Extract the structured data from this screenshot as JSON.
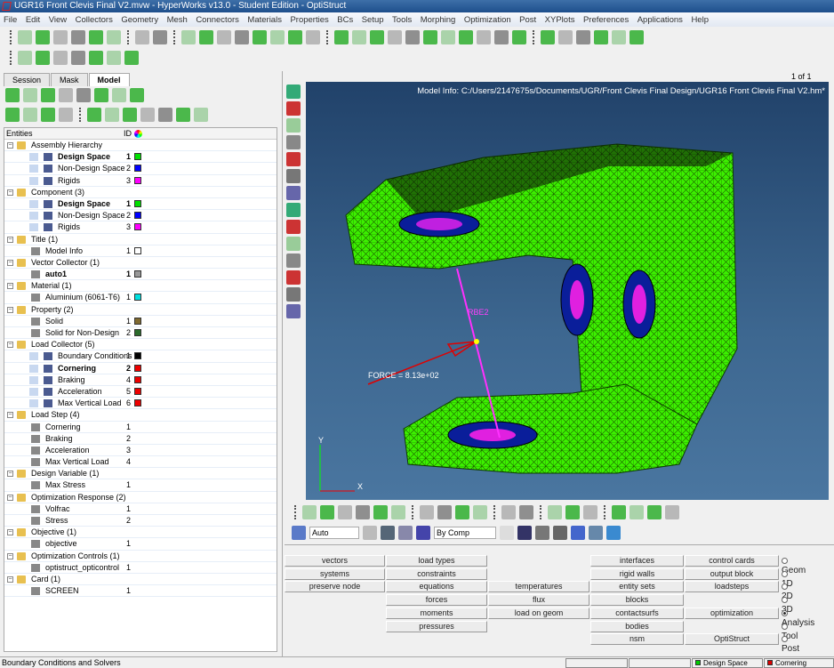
{
  "window": {
    "title": "UGR16 Front Clevis Final V2.mvw - HyperWorks v13.0 - Student Edition - OptiStruct"
  },
  "menu": [
    "File",
    "Edit",
    "View",
    "Collectors",
    "Geometry",
    "Mesh",
    "Connectors",
    "Materials",
    "Properties",
    "BCs",
    "Setup",
    "Tools",
    "Morphing",
    "Optimization",
    "Post",
    "XYPlots",
    "Preferences",
    "Applications",
    "Help"
  ],
  "tabs": [
    {
      "label": "Session"
    },
    {
      "label": "Mask"
    },
    {
      "label": "Model",
      "active": true
    }
  ],
  "tree": {
    "header": {
      "entities": "Entities",
      "id": "ID"
    },
    "rows": [
      {
        "level": 0,
        "label": "Assembly Hierarchy"
      },
      {
        "level": 1,
        "label": "Design Space",
        "id": "1",
        "color": "#00e000",
        "bold": true
      },
      {
        "level": 1,
        "label": "Non-Design Space",
        "id": "2",
        "color": "#0000ff"
      },
      {
        "level": 1,
        "label": "Rigids",
        "id": "3",
        "color": "#ff00ff"
      },
      {
        "level": 0,
        "label": "Component (3)"
      },
      {
        "level": 1,
        "label": "Design Space",
        "id": "1",
        "color": "#00e000",
        "bold": true
      },
      {
        "level": 1,
        "label": "Non-Design Space",
        "id": "2",
        "color": "#0000ff"
      },
      {
        "level": 1,
        "label": "Rigids",
        "id": "3",
        "color": "#ff00ff"
      },
      {
        "level": 0,
        "label": "Title (1)"
      },
      {
        "level": 1,
        "label": "Model Info",
        "id": "1",
        "color": "#ffffff",
        "short": true
      },
      {
        "level": 0,
        "label": "Vector Collector (1)"
      },
      {
        "level": 1,
        "label": "auto1",
        "id": "1",
        "color": "#999999",
        "bold": true,
        "short": true
      },
      {
        "level": 0,
        "label": "Material (1)"
      },
      {
        "level": 1,
        "label": "Aluminium (6061-T6)",
        "id": "1",
        "color": "#00e0e0",
        "short": true
      },
      {
        "level": 0,
        "label": "Property (2)"
      },
      {
        "level": 1,
        "label": "Solid",
        "id": "1",
        "color": "#806a30",
        "short": true
      },
      {
        "level": 1,
        "label": "Solid for Non-Design",
        "id": "2",
        "color": "#2a6a2a",
        "short": true
      },
      {
        "level": 0,
        "label": "Load Collector (5)"
      },
      {
        "level": 1,
        "label": "Boundary Conditions",
        "id": "1",
        "color": "#000000"
      },
      {
        "level": 1,
        "label": "Cornering",
        "id": "2",
        "color": "#ee0000",
        "bold": true
      },
      {
        "level": 1,
        "label": "Braking",
        "id": "4",
        "color": "#ee0000"
      },
      {
        "level": 1,
        "label": "Acceleration",
        "id": "5",
        "color": "#ee0000"
      },
      {
        "level": 1,
        "label": "Max Vertical Load",
        "id": "6",
        "color": "#ee0000"
      },
      {
        "level": 0,
        "label": "Load Step (4)"
      },
      {
        "level": 1,
        "label": "Cornering",
        "id": "1",
        "short": true
      },
      {
        "level": 1,
        "label": "Braking",
        "id": "2",
        "short": true
      },
      {
        "level": 1,
        "label": "Acceleration",
        "id": "3",
        "short": true
      },
      {
        "level": 1,
        "label": "Max Vertical Load",
        "id": "4",
        "short": true
      },
      {
        "level": 0,
        "label": "Design Variable (1)"
      },
      {
        "level": 1,
        "label": "Max Stress",
        "id": "1",
        "short": true
      },
      {
        "level": 0,
        "label": "Optimization Response (2)"
      },
      {
        "level": 1,
        "label": "Volfrac",
        "id": "1",
        "short": true
      },
      {
        "level": 1,
        "label": "Stress",
        "id": "2",
        "short": true
      },
      {
        "level": 0,
        "label": "Objective (1)"
      },
      {
        "level": 1,
        "label": "objective",
        "id": "1",
        "short": true
      },
      {
        "level": 0,
        "label": "Optimization Controls (1)"
      },
      {
        "level": 1,
        "label": "optistruct_opticontrol",
        "id": "1",
        "short": true
      },
      {
        "level": 0,
        "label": "Card (1)"
      },
      {
        "level": 1,
        "label": "SCREEN",
        "id": "1",
        "short": true
      }
    ]
  },
  "viewport": {
    "page": "1 of 1",
    "model_info": "Model Info: C:/Users/2147675s/Documents/UGR/Front Clevis Final Design/UGR16 Front Clevis Final V2.hm*",
    "rbe_label": "RBE2",
    "force_label": "FORCE = 8.13e+02",
    "axis": {
      "y": "Y",
      "x": "X"
    }
  },
  "display_toolbar": {
    "auto": "Auto",
    "by_comp": "By Comp"
  },
  "panel": {
    "buttons": [
      [
        "vectors",
        "systems",
        "preserve node"
      ],
      [
        "load types",
        "constraints",
        "equations",
        "forces",
        "moments",
        "pressures"
      ],
      [
        "temperatures",
        "flux",
        "load on geom"
      ],
      [
        "interfaces",
        "rigid walls",
        "entity sets",
        "blocks",
        "contactsurfs",
        "bodies",
        "nsm"
      ],
      [
        "control cards",
        "output block",
        "loadsteps",
        "optimization",
        "OptiStruct"
      ]
    ],
    "radios": [
      {
        "label": "Geom"
      },
      {
        "label": "1D"
      },
      {
        "label": "2D"
      },
      {
        "label": "3D"
      },
      {
        "label": "Analysis",
        "selected": true
      },
      {
        "label": "Tool"
      },
      {
        "label": "Post"
      }
    ]
  },
  "status": {
    "text": "Boundary Conditions and Solvers",
    "component": "Design Space",
    "component_color": "#00cc00",
    "loadcol": "Cornering",
    "loadcol_color": "#dd0000"
  }
}
